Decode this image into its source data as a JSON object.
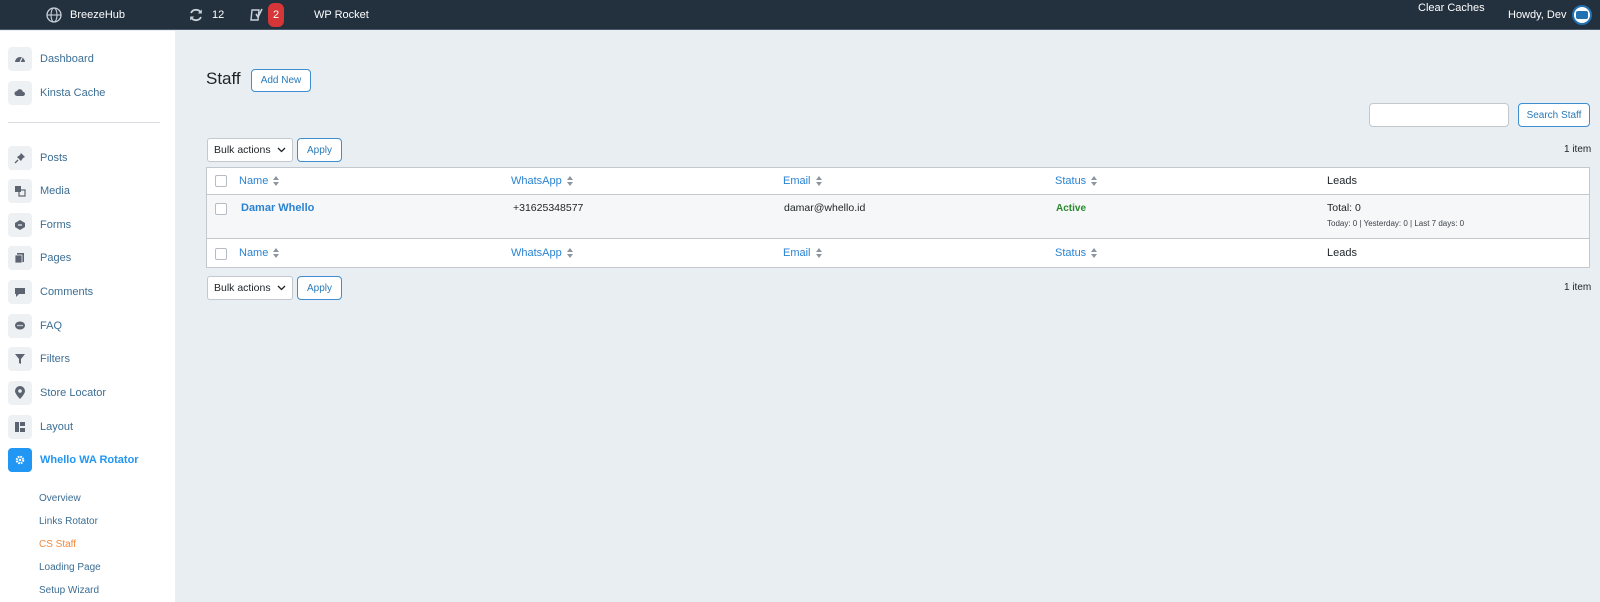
{
  "adminbar": {
    "site_name": "BreezeHub",
    "updates_count": "12",
    "yoast_badge": "2",
    "rocket_label": "WP Rocket",
    "clear_caches": "Clear Caches",
    "howdy": "Howdy, Dev"
  },
  "sidebar": {
    "items": [
      {
        "label": "Dashboard",
        "icon": "dashboard-icon"
      },
      {
        "label": "Kinsta Cache",
        "icon": "cloud-icon"
      },
      {
        "label": "Posts",
        "icon": "pin-icon"
      },
      {
        "label": "Media",
        "icon": "media-icon"
      },
      {
        "label": "Forms",
        "icon": "forms-icon"
      },
      {
        "label": "Pages",
        "icon": "pages-icon"
      },
      {
        "label": "Comments",
        "icon": "comment-icon"
      },
      {
        "label": "FAQ",
        "icon": "chat-icon"
      },
      {
        "label": "Filters",
        "icon": "filter-icon"
      },
      {
        "label": "Store Locator",
        "icon": "location-pin-icon"
      },
      {
        "label": "Layout",
        "icon": "layout-icon"
      },
      {
        "label": "Whello WA Rotator",
        "icon": "gear-icon"
      }
    ],
    "submenu": [
      "Overview",
      "Links Rotator",
      "CS Staff",
      "Loading Page",
      "Setup Wizard"
    ]
  },
  "main": {
    "title": "Staff",
    "add_new": "Add New",
    "search_button": "Search Staff",
    "search_value": "",
    "bulk_actions": "Bulk actions",
    "apply": "Apply",
    "items_count": "1 item",
    "columns": [
      "Name",
      "WhatsApp",
      "Email",
      "Status",
      "Leads"
    ],
    "rows": [
      {
        "name": "Damar Whello",
        "whatsapp": "+31625348577",
        "email": "damar@whello.id",
        "status": "Active",
        "leads_total": "Total: 0",
        "leads_detail": "Today: 0 | Yesterday: 0 | Last 7 days: 0"
      }
    ]
  },
  "colors": {
    "adminbar_bg": "#23303e",
    "accent": "#2196f3",
    "current_submenu": "#f0883e",
    "status_active": "#2a8a2e",
    "badge": "#d63638"
  }
}
